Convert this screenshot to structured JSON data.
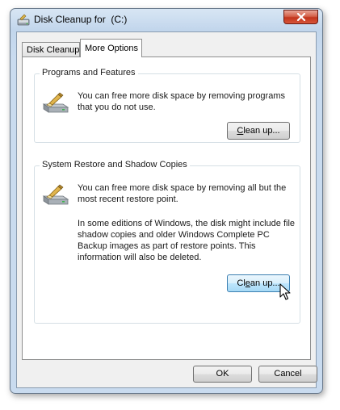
{
  "window": {
    "title": "Disk Cleanup for  (C:)",
    "close_glyph": "✕",
    "icons": {
      "title": "disk-cleanup-icon",
      "close": "close-icon"
    }
  },
  "tabs": [
    {
      "label": "Disk Cleanup",
      "active": false
    },
    {
      "label": "More Options",
      "active": true
    }
  ],
  "programs": {
    "heading": "Programs and Features",
    "description": "You can free more disk space by removing programs that you do not use.",
    "button": {
      "prefix": "",
      "mnemonic": "C",
      "suffix": "lean up..."
    },
    "icon": "programs-drive-icon"
  },
  "restore": {
    "heading": "System Restore and Shadow Copies",
    "description": "You can free more disk space by removing all but the most recent restore point.",
    "note": "In some editions of Windows, the disk might include file shadow copies and older Windows Complete PC Backup images as part of restore points. This information will also be deleted.",
    "button": {
      "prefix": "Cl",
      "mnemonic": "e",
      "suffix": "an up..."
    },
    "icon": "restore-drive-icon"
  },
  "footer": {
    "ok": "OK",
    "cancel": "Cancel"
  },
  "colors": {
    "title_bar": "#c2d6ec",
    "close_button": "#c2351c",
    "hot_button": "#bee6fd"
  }
}
